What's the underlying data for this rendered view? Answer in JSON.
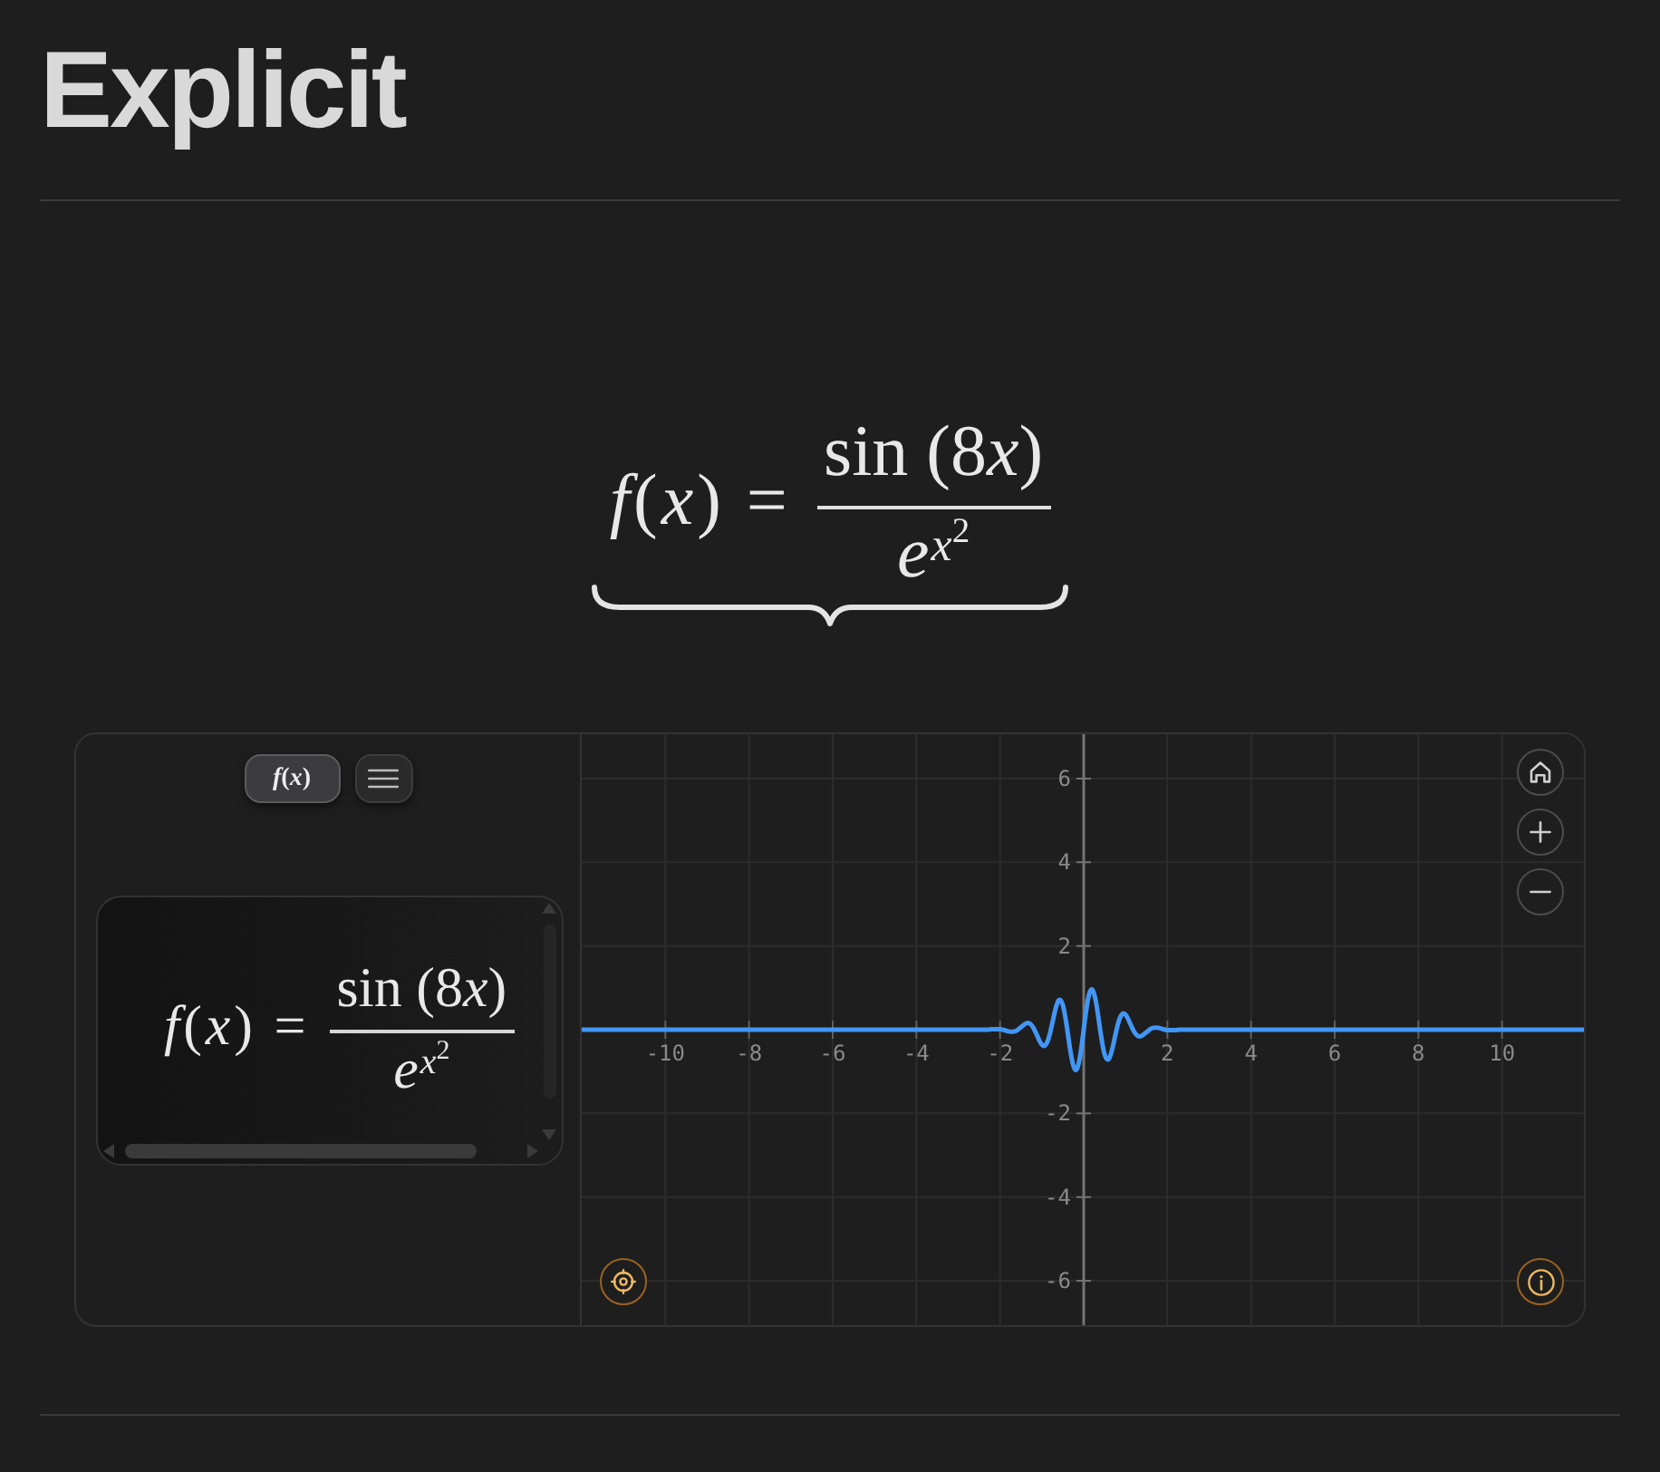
{
  "page": {
    "title": "Explicit"
  },
  "formula": {
    "lhs": "*f*(*x*) =",
    "numerator": [
      {
        "text": "sin (8",
        "italic": false
      },
      {
        "text": "x",
        "italic": true
      },
      {
        "text": ")",
        "italic": false
      }
    ],
    "denominator_base": "e",
    "denominator_exponent": "*x*$^{2}$",
    "underbrace": true
  },
  "plotter": {
    "toolbar": [
      {
        "kind": "expression",
        "label": "*f*(*x*)",
        "selected": true
      },
      {
        "kind": "menu",
        "selected": false
      }
    ],
    "expression": {
      "lhs": "*f*(*x*) =",
      "numerator": [
        {
          "text": "sin (8",
          "italic": false
        },
        {
          "text": "x",
          "italic": true
        },
        {
          "text": ")",
          "italic": false
        }
      ],
      "denominator_base": "e",
      "denominator_exponent": "*x*$^{2}$"
    },
    "graph": {
      "chart_data": {
        "type": "line",
        "x": [
          -12,
          -3,
          -2.5,
          -2.3,
          -2.2,
          -2.1,
          -2,
          -1.9,
          -1.8,
          -1.75,
          -1.7,
          -1.65,
          -1.6,
          -1.55,
          -1.5,
          -1.45,
          -1.4,
          -1.35,
          -1.3,
          -1.25,
          -1.2,
          -1.15,
          -1.1,
          -1.05,
          -1,
          -0.95,
          -0.9,
          -0.85,
          -0.8,
          -0.75,
          -0.7,
          -0.65,
          -0.6,
          -0.55,
          -0.5,
          -0.45,
          -0.4,
          -0.35,
          -0.3,
          -0.25,
          -0.2,
          -0.15,
          -0.1,
          -0.05,
          0,
          0.05,
          0.1,
          0.15,
          0.2,
          0.25,
          0.3,
          0.35,
          0.4,
          0.45,
          0.5,
          0.55,
          0.6,
          0.65,
          0.7,
          0.75,
          0.8,
          0.85,
          0.9,
          0.95,
          1,
          1.05,
          1.1,
          1.15,
          1.2,
          1.25,
          1.3,
          1.35,
          1.4,
          1.45,
          1.5,
          1.55,
          1.6,
          1.65,
          1.7,
          1.75,
          1.8,
          1.9,
          2,
          2.1,
          2.2,
          2.3,
          2.5,
          3,
          12
        ],
        "series": [
          {
            "color": "#4296f5",
            "values": [
              0,
              0,
              0,
              0,
              0.01,
              0.01,
              0.01,
              -0.01,
              -0.04,
              -0.05,
              -0.05,
              -0.04,
              -0.02,
              0.02,
              0.06,
              0.1,
              0.14,
              0.16,
              0.15,
              0.11,
              0.04,
              -0.06,
              -0.17,
              -0.28,
              -0.36,
              -0.39,
              -0.35,
              -0.24,
              -0.06,
              0.16,
              0.39,
              0.58,
              0.7,
              0.7,
              0.59,
              0.36,
              0.05,
              -0.3,
              -0.62,
              -0.85,
              -0.96,
              -0.91,
              -0.71,
              -0.39,
              0,
              0.39,
              0.71,
              0.91,
              0.96,
              0.85,
              0.62,
              0.3,
              -0.05,
              -0.36,
              -0.59,
              -0.7,
              -0.7,
              -0.58,
              -0.39,
              -0.16,
              0.06,
              0.24,
              0.35,
              0.39,
              0.36,
              0.28,
              0.17,
              0.06,
              -0.04,
              -0.11,
              -0.15,
              -0.16,
              -0.14,
              -0.1,
              -0.06,
              -0.02,
              0.02,
              0.04,
              0.05,
              0.05,
              0.04,
              0.01,
              -0.01,
              -0.01,
              -0.01,
              0,
              0,
              0,
              0
            ]
          }
        ],
        "xlim": [
          -12,
          12
        ],
        "ylim": [
          -7.06,
          7.06
        ],
        "xticks": [
          -10,
          -8,
          -6,
          -4,
          -2,
          2,
          4,
          6,
          8,
          10
        ],
        "yticks": [
          -6,
          -4,
          -2,
          2,
          4,
          6
        ],
        "grid": true
      },
      "view_controls": [
        {
          "kind": "home"
        },
        {
          "kind": "zoom_in"
        },
        {
          "kind": "zoom_out"
        }
      ],
      "corner_buttons": [
        {
          "kind": "locate"
        },
        {
          "kind": "info"
        }
      ]
    }
  }
}
